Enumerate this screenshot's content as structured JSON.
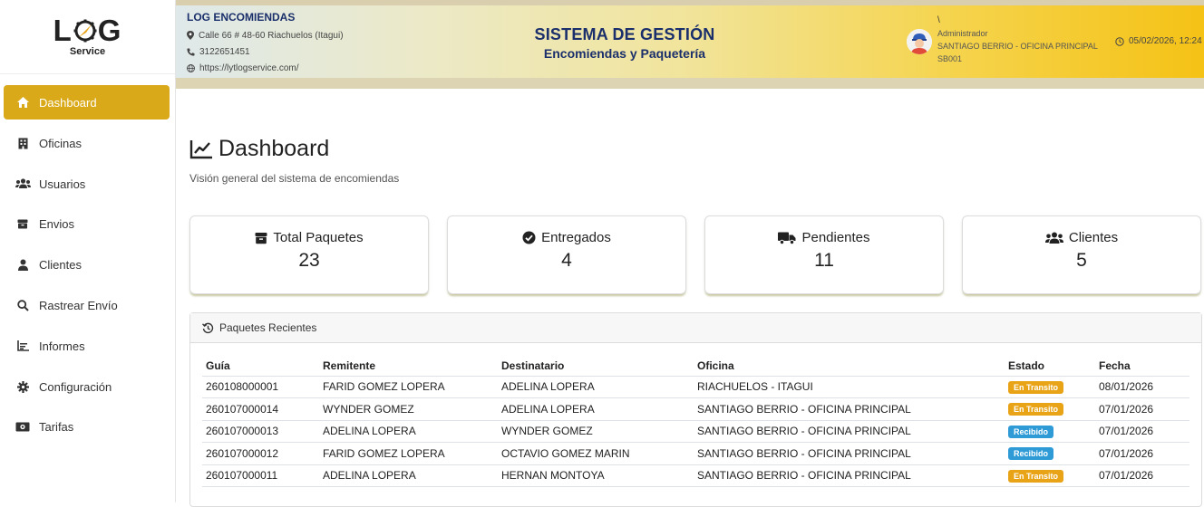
{
  "logo": {
    "word_left": "L",
    "word_right": "G",
    "sub": "Service"
  },
  "sidebar": {
    "items": [
      {
        "label": "Dashboard",
        "icon": "home-icon",
        "active": true
      },
      {
        "label": "Oficinas",
        "icon": "building-icon"
      },
      {
        "label": "Usuarios",
        "icon": "users-icon"
      },
      {
        "label": "Envios",
        "icon": "box-icon"
      },
      {
        "label": "Clientes",
        "icon": "user-icon"
      },
      {
        "label": "Rastrear Envío",
        "icon": "search-icon"
      },
      {
        "label": "Informes",
        "icon": "chart-icon"
      },
      {
        "label": "Configuración",
        "icon": "gear-icon"
      },
      {
        "label": "Tarifas",
        "icon": "money-icon"
      }
    ]
  },
  "header": {
    "company_name": "LOG ENCOMIENDAS",
    "address": "Calle 66 # 48-60 Riachuelos (Itagui)",
    "phone": "3122651451",
    "website": "https://lytlogservice.com/",
    "title": "SISTEMA DE GESTIÓN",
    "subtitle": "Encomiendas y Paquetería",
    "user_mark": "\\",
    "user_role": "Administrador",
    "user_office": "SANTIAGO BERRIO - OFICINA PRINCIPAL",
    "user_code": "SB001",
    "datetime": "05/02/2026, 12:24"
  },
  "main": {
    "title": "Dashboard",
    "subtitle": "Visión general del sistema de encomiendas"
  },
  "cards": [
    {
      "label": "Total Paquetes",
      "value": "23",
      "icon": "box-icon"
    },
    {
      "label": "Entregados",
      "value": "4",
      "icon": "check-circle-icon"
    },
    {
      "label": "Pendientes",
      "value": "11",
      "icon": "truck-icon"
    },
    {
      "label": "Clientes",
      "value": "5",
      "icon": "users-icon"
    }
  ],
  "recent": {
    "title": "Paquetes Recientes",
    "columns": [
      "Guía",
      "Remitente",
      "Destinatario",
      "Oficina",
      "Estado",
      "Fecha"
    ],
    "rows": [
      {
        "guia": "260108000001",
        "remitente": "FARID GOMEZ LOPERA",
        "destinatario": "ADELINA LOPERA",
        "oficina": "RIACHUELOS - ITAGUI",
        "estado": "En Transito",
        "fecha": "08/01/2026"
      },
      {
        "guia": "260107000014",
        "remitente": "WYNDER GOMEZ",
        "destinatario": "ADELINA LOPERA",
        "oficina": "SANTIAGO BERRIO - OFICINA PRINCIPAL",
        "estado": "En Transito",
        "fecha": "07/01/2026"
      },
      {
        "guia": "260107000013",
        "remitente": "ADELINA LOPERA",
        "destinatario": "WYNDER GOMEZ",
        "oficina": "SANTIAGO BERRIO - OFICINA PRINCIPAL",
        "estado": "Recibido",
        "fecha": "07/01/2026"
      },
      {
        "guia": "260107000012",
        "remitente": "FARID GOMEZ LOPERA",
        "destinatario": "OCTAVIO GOMEZ MARIN",
        "oficina": "SANTIAGO BERRIO - OFICINA PRINCIPAL",
        "estado": "Recibido",
        "fecha": "07/01/2026"
      },
      {
        "guia": "260107000011",
        "remitente": "ADELINA LOPERA",
        "destinatario": "HERNAN MONTOYA",
        "oficina": "SANTIAGO BERRIO - OFICINA PRINCIPAL",
        "estado": "En Transito",
        "fecha": "07/01/2026"
      }
    ]
  },
  "colors": {
    "accent": "#d9a91a",
    "title_blue": "#1a2f6b",
    "badge_transit": "#e8a317",
    "badge_received": "#2f9bd6"
  }
}
